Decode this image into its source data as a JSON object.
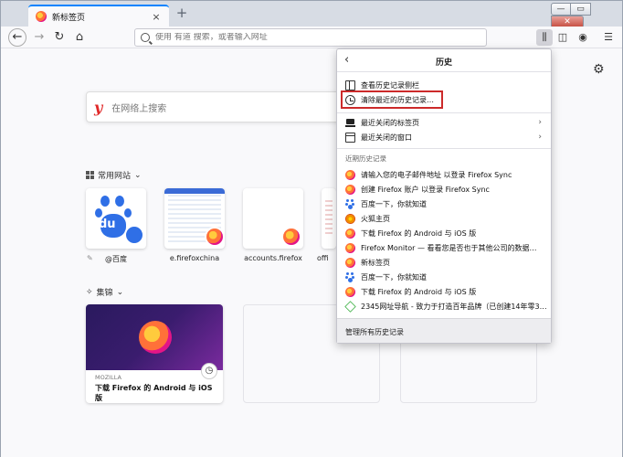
{
  "browser": {
    "tab_title": "新标签页",
    "tab_close": "×",
    "new_tab": "+",
    "window_min": "—",
    "window_max": "▭",
    "window_close": "✕"
  },
  "navbar": {
    "url_placeholder": "使用 有道 搜索，或者输入网址"
  },
  "content": {
    "search_logo": "y",
    "search_placeholder": "在网络上搜索",
    "top_sites_heading": "常用网站",
    "highlights_heading": "集锦",
    "top_sites": [
      {
        "label": "@百度"
      },
      {
        "label": "e.firefoxchina"
      },
      {
        "label": "accounts.firefox"
      },
      {
        "label": "offi"
      }
    ],
    "highlight_card": {
      "source": "MOZILLA",
      "title": "下载 Firefox 的 Android 与 iOS 版"
    }
  },
  "history_panel": {
    "title": "历史",
    "show_sidebar": "查看历史记录侧栏",
    "clear_recent": "清除最近的历史记录…",
    "recent_tabs": "最近关闭的标签页",
    "recent_windows": "最近关闭的窗口",
    "recent_history_label": "近期历史记录",
    "items": [
      {
        "label": "请输入您的电子邮件地址 以登录 Firefox Sync",
        "icon": "firefox-icon"
      },
      {
        "label": "创建 Firefox 账户 以登录 Firefox Sync",
        "icon": "firefox-icon"
      },
      {
        "label": "百度一下，你就知道",
        "icon": "baidu-icon"
      },
      {
        "label": "火狐主页",
        "icon": "firefox-icon"
      },
      {
        "label": "下载 Firefox 的 Android 与 iOS 版",
        "icon": "firefox-icon"
      },
      {
        "label": "Firefox Monitor — 看看您是否也于其他公司的数据…",
        "icon": "firefox-icon"
      },
      {
        "label": "新标签页",
        "icon": "firefox-icon"
      },
      {
        "label": "百度一下，你就知道",
        "icon": "baidu-icon"
      },
      {
        "label": "下载 Firefox 的 Android 与 iOS 版",
        "icon": "firefox-icon"
      },
      {
        "label": "2345网址导航 - 致力于打造百年品牌（已创建14年零3…",
        "icon": "2345-icon"
      }
    ],
    "footer": "管理所有历史记录"
  },
  "colors": {
    "accent": "#0a84ff",
    "highlight_border": "#cc2a2a",
    "baidu_blue": "#2f6fe6"
  }
}
